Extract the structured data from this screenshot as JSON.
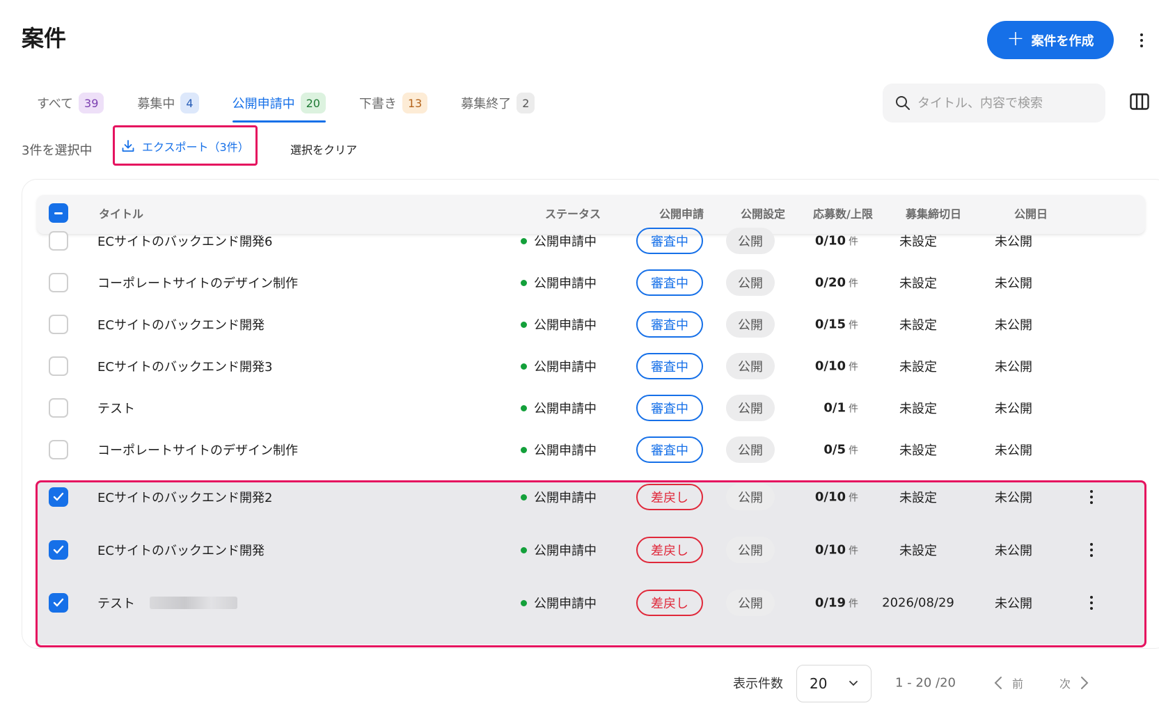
{
  "page": {
    "title": "案件"
  },
  "header": {
    "create_label": "案件を作成"
  },
  "tabs": [
    {
      "label": "すべて",
      "count": "39",
      "count_bg": "#eee0f8",
      "count_color": "#7b3fb0",
      "active": false
    },
    {
      "label": "募集中",
      "count": "4",
      "count_bg": "#dde8fb",
      "count_color": "#2a5fb8",
      "active": false
    },
    {
      "label": "公開申請中",
      "count": "20",
      "count_bg": "#dcf2df",
      "count_color": "#1f7a35",
      "active": true
    },
    {
      "label": "下書き",
      "count": "13",
      "count_bg": "#fdecd6",
      "count_color": "#b4641c",
      "active": false
    },
    {
      "label": "募集終了",
      "count": "2",
      "count_bg": "#ececec",
      "count_color": "#555555",
      "active": false
    }
  ],
  "search": {
    "placeholder": "タイトル、内容で検索"
  },
  "bulk": {
    "selected_text": "3件を選択中",
    "export_label": "エクスポート（3件）",
    "clear_label": "選択をクリア"
  },
  "table": {
    "headers": {
      "title": "タイトル",
      "status": "ステータス",
      "publish_request": "公開申請",
      "publish_setting": "公開設定",
      "applications": "応募数/上限",
      "deadline": "募集締切日",
      "publish_date": "公開日"
    },
    "rows": [
      {
        "checked": false,
        "title": "ECサイトのバックエンド開発6",
        "status": "公開申請中",
        "request": "審査中",
        "request_type": "review",
        "setting": "公開",
        "apps": "0/10",
        "unit": "件",
        "deadline": "未設定",
        "published": "未公開",
        "more": false
      },
      {
        "checked": false,
        "title": "コーポレートサイトのデザイン制作",
        "status": "公開申請中",
        "request": "審査中",
        "request_type": "review",
        "setting": "公開",
        "apps": "0/20",
        "unit": "件",
        "deadline": "未設定",
        "published": "未公開",
        "more": false
      },
      {
        "checked": false,
        "title": "ECサイトのバックエンド開発",
        "status": "公開申請中",
        "request": "審査中",
        "request_type": "review",
        "setting": "公開",
        "apps": "0/15",
        "unit": "件",
        "deadline": "未設定",
        "published": "未公開",
        "more": false
      },
      {
        "checked": false,
        "title": "ECサイトのバックエンド開発3",
        "status": "公開申請中",
        "request": "審査中",
        "request_type": "review",
        "setting": "公開",
        "apps": "0/10",
        "unit": "件",
        "deadline": "未設定",
        "published": "未公開",
        "more": false
      },
      {
        "checked": false,
        "title": "テスト",
        "status": "公開申請中",
        "request": "審査中",
        "request_type": "review",
        "setting": "公開",
        "apps": "0/1",
        "unit": "件",
        "deadline": "未設定",
        "published": "未公開",
        "more": false
      },
      {
        "checked": false,
        "title": "コーポレートサイトのデザイン制作",
        "status": "公開申請中",
        "request": "審査中",
        "request_type": "review",
        "setting": "公開",
        "apps": "0/5",
        "unit": "件",
        "deadline": "未設定",
        "published": "未公開",
        "more": false
      },
      {
        "checked": true,
        "title": "ECサイトのバックエンド開発2",
        "status": "公開申請中",
        "request": "差戻し",
        "request_type": "returned",
        "setting": "公開",
        "apps": "0/10",
        "unit": "件",
        "deadline": "未設定",
        "published": "未公開",
        "more": true
      },
      {
        "checked": true,
        "title": "ECサイトのバックエンド開発",
        "status": "公開申請中",
        "request": "差戻し",
        "request_type": "returned",
        "setting": "公開",
        "apps": "0/10",
        "unit": "件",
        "deadline": "未設定",
        "published": "未公開",
        "more": true
      },
      {
        "checked": true,
        "title": "テスト",
        "status": "公開申請中",
        "request": "差戻し",
        "request_type": "returned",
        "setting": "公開",
        "apps": "0/19",
        "unit": "件",
        "deadline": "2026/08/29",
        "published": "未公開",
        "more": true,
        "redacted": true
      }
    ]
  },
  "pagination": {
    "per_page_label": "表示件数",
    "per_page_value": "20",
    "range": "1 - 20 /20",
    "prev_label": "前",
    "next_label": "次"
  },
  "colors": {
    "accent": "#1670e8",
    "highlight": "#e5135f",
    "returned": "#e0283a",
    "status_dot": "#13a03a"
  }
}
